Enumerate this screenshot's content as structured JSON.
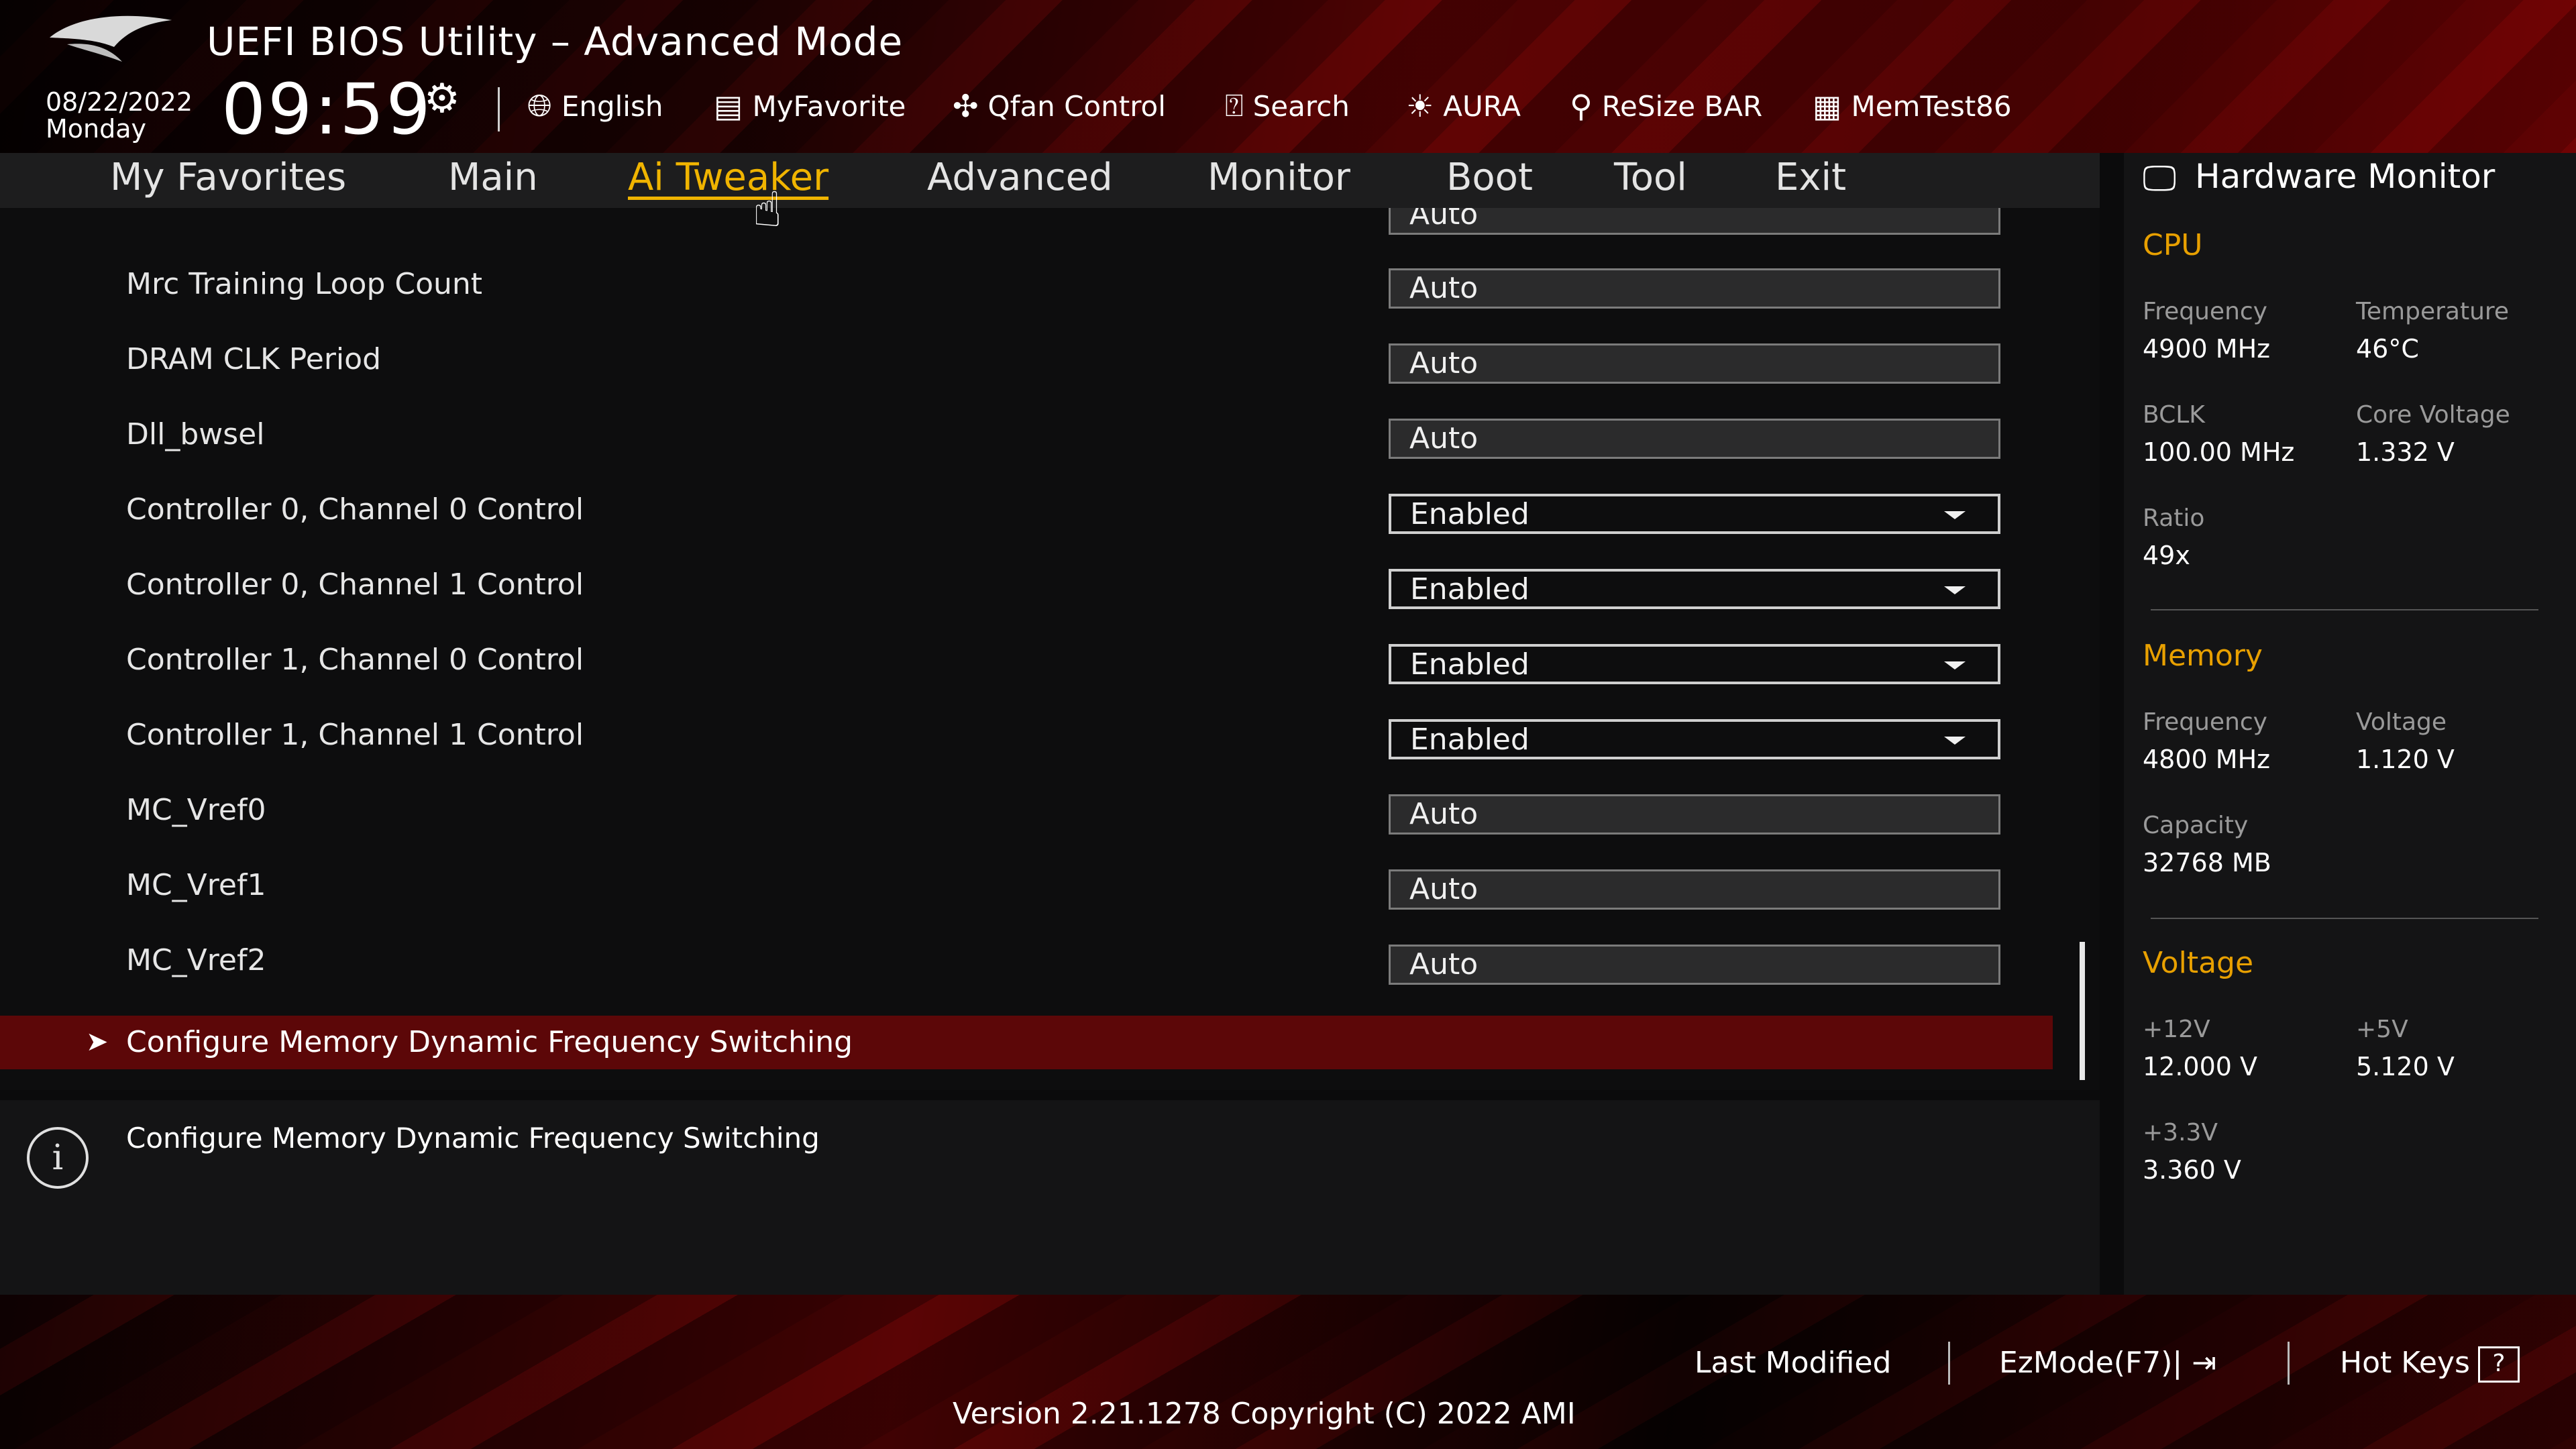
{
  "header": {
    "title": "UEFI BIOS Utility – Advanced Mode",
    "date": "08/22/2022",
    "day": "Monday",
    "time": "09:59",
    "tools": [
      {
        "label": "English",
        "icon": "globe-icon"
      },
      {
        "label": "MyFavorite",
        "icon": "favorite-icon"
      },
      {
        "label": "Qfan Control",
        "icon": "fan-icon"
      },
      {
        "label": "Search",
        "icon": "search-icon"
      },
      {
        "label": "AURA",
        "icon": "aura-icon"
      },
      {
        "label": "ReSize BAR",
        "icon": "resize-bar-icon"
      },
      {
        "label": "MemTest86",
        "icon": "memtest-icon"
      }
    ]
  },
  "nav": {
    "tabs": [
      "My Favorites",
      "Main",
      "Ai Tweaker",
      "Advanced",
      "Monitor",
      "Boot",
      "Tool",
      "Exit"
    ],
    "active": "Ai Tweaker"
  },
  "settings": [
    {
      "label": "Mrc Training Loop Count",
      "value": "Auto",
      "dropdown": false
    },
    {
      "label": "DRAM CLK Period",
      "value": "Auto",
      "dropdown": false
    },
    {
      "label": "Dll_bwsel",
      "value": "Auto",
      "dropdown": false
    },
    {
      "label": "Controller 0, Channel 0 Control",
      "value": "Enabled",
      "dropdown": true
    },
    {
      "label": "Controller 0, Channel 1 Control",
      "value": "Enabled",
      "dropdown": true
    },
    {
      "label": "Controller 1, Channel 0 Control",
      "value": "Enabled",
      "dropdown": true
    },
    {
      "label": "Controller 1, Channel 1 Control",
      "value": "Enabled",
      "dropdown": true
    },
    {
      "label": "MC_Vref0",
      "value": "Auto",
      "dropdown": false
    },
    {
      "label": "MC_Vref1",
      "value": "Auto",
      "dropdown": false
    },
    {
      "label": "MC_Vref2",
      "value": "Auto",
      "dropdown": false
    }
  ],
  "partial_top": {
    "value": "Auto"
  },
  "selected_submenu": {
    "label": "Configure Memory Dynamic Frequency Switching"
  },
  "help": {
    "text": "Configure Memory Dynamic Frequency Switching"
  },
  "hardware_monitor": {
    "title": "Hardware Monitor",
    "cpu": {
      "heading": "CPU",
      "frequency_label": "Frequency",
      "frequency": "4900 MHz",
      "temperature_label": "Temperature",
      "temperature": "46°C",
      "bclk_label": "BCLK",
      "bclk": "100.00 MHz",
      "core_voltage_label": "Core Voltage",
      "core_voltage": "1.332 V",
      "ratio_label": "Ratio",
      "ratio": "49x"
    },
    "memory": {
      "heading": "Memory",
      "frequency_label": "Frequency",
      "frequency": "4800 MHz",
      "voltage_label": "Voltage",
      "voltage": "1.120 V",
      "capacity_label": "Capacity",
      "capacity": "32768 MB"
    },
    "voltage": {
      "heading": "Voltage",
      "v12_label": "+12V",
      "v12": "12.000 V",
      "v5_label": "+5V",
      "v5": "5.120 V",
      "v33_label": "+3.3V",
      "v33": "3.360 V"
    }
  },
  "footer": {
    "last_modified": "Last Modified",
    "ezmode": "EzMode(F7)|",
    "hot_keys": "Hot Keys",
    "hot_keys_glyph": "?",
    "version": "Version 2.21.1278 Copyright (C) 2022 AMI"
  },
  "colors": {
    "accent": "#f0b400",
    "selected_row": "#5c0708",
    "section_heading": "#e8a000"
  }
}
